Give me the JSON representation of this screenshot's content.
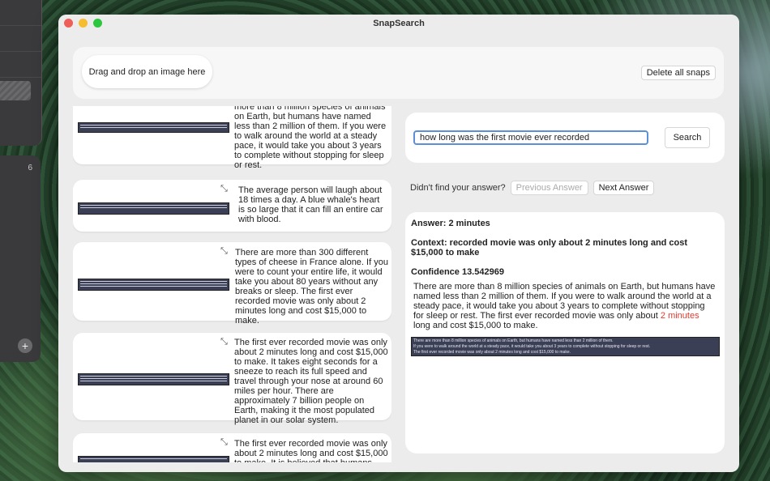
{
  "window": {
    "title": "SnapSearch"
  },
  "background": {
    "sidebar_count": "6"
  },
  "dropzone": {
    "label": "Drag and drop an image here"
  },
  "toolbar": {
    "delete_label": "Delete all snaps"
  },
  "snaps": [
    {
      "text": "more than 8 million species of animals on Earth, but humans have named less than 2 million of them. If you were to walk around the world at a steady pace, it would take you about 3 years to complete without stopping for sleep or rest."
    },
    {
      "text": "The average person will laugh about 18 times a day. A blue whale's heart is so large that it can fill an entire car with blood.",
      "img_text": "The average person will laugh about 18 times a day. A blue whale's heart is so large that it can fill an entire car with blood."
    },
    {
      "text": "There are more than 300 different types of cheese in France alone. If you were to count your entire life, it would take you about 80 years without any breaks or sleep. The first ever recorded movie was only about 2 minutes long and cost $15,000 to make."
    },
    {
      "text": "The first ever recorded movie was only about 2 minutes long and cost $15,000 to make. It takes eight seconds for a sneeze to reach its full speed and travel through your nose at around 60 miles per hour. There are approximately 7 billion people on Earth, making it the most populated planet in our solar system."
    },
    {
      "text": "The first ever recorded movie was only about 2 minutes long and cost $15,000 to make. It is believed that humans have"
    }
  ],
  "search": {
    "query": "how long was the first movie ever recorded",
    "button_label": "Search"
  },
  "navigation": {
    "prompt": "Didn't find your answer?",
    "previous_label": "Previous Answer",
    "next_label": "Next Answer"
  },
  "answer": {
    "answer_line": "Answer: 2 minutes",
    "context_line": "Context: recorded movie was only about 2 minutes long and cost $15,000 to make",
    "confidence_line": "Confidence 13.542969",
    "para_before": "There are more than 8 million species of animals on Earth, but humans have named less than 2 million of them. If you were to walk around the world at a steady pace, it would take you about 3 years to complete without stopping for sleep or rest. The first ever recorded movie was only about ",
    "para_highlight": "2 minutes",
    "para_after": " long and cost $15,000 to make.",
    "img_lines": [
      "There are more than 8 million species of animals on Earth, but humans have named less than 2 million of them.",
      "If you were to walk around the world at a steady pace, it would take you about 3 years to complete without stopping for sleep or rest.",
      "The first ever recorded movie was only about 2 minutes long and cost $15,000 to make."
    ]
  },
  "colors": {
    "highlight": "#e53b2f",
    "focus_ring": "#5d8fd8",
    "snap_image_bg": "#3a3f56"
  },
  "icons": {
    "expand": "expand-arrows-icon",
    "plus": "plus-icon"
  }
}
